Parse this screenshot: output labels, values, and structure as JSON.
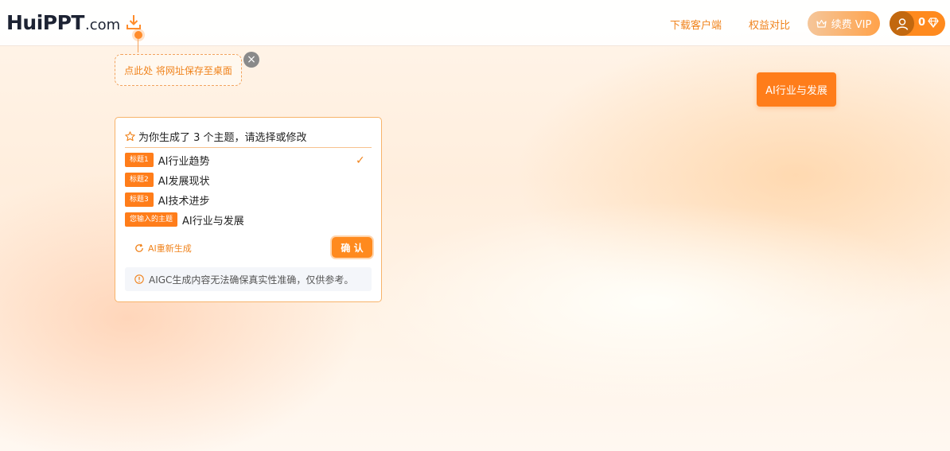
{
  "header": {
    "logo_text": "HuiPPT",
    "logo_suffix": ".com",
    "download_client": "下载客户端",
    "benefits_compare": "权益对比",
    "vip_button": "续费 VIP",
    "coin_count": "0"
  },
  "tip": {
    "text": "点此处 将网址保存至桌面",
    "close": "×"
  },
  "floating_topic": "AI行业与发展",
  "panel": {
    "heading": "为你生成了 3 个主题，请选择或修改",
    "options": [
      {
        "tag": "标题1",
        "text": "AI行业趋势",
        "selected": true
      },
      {
        "tag": "标题2",
        "text": "AI发展现状",
        "selected": false
      },
      {
        "tag": "标题3",
        "text": "AI技术进步",
        "selected": false
      },
      {
        "tag": "您输入的主题",
        "text": "AI行业与发展",
        "selected": false
      }
    ],
    "check_mark": "✓",
    "regenerate": "AI重新生成",
    "confirm": "确 认",
    "disclaimer": "AIGC生成内容无法确保真实性准确，仅供参考。"
  },
  "colors": {
    "accent": "#ff7d1a",
    "accent_text": "#f0831c",
    "panel_border": "#f7b36a"
  }
}
